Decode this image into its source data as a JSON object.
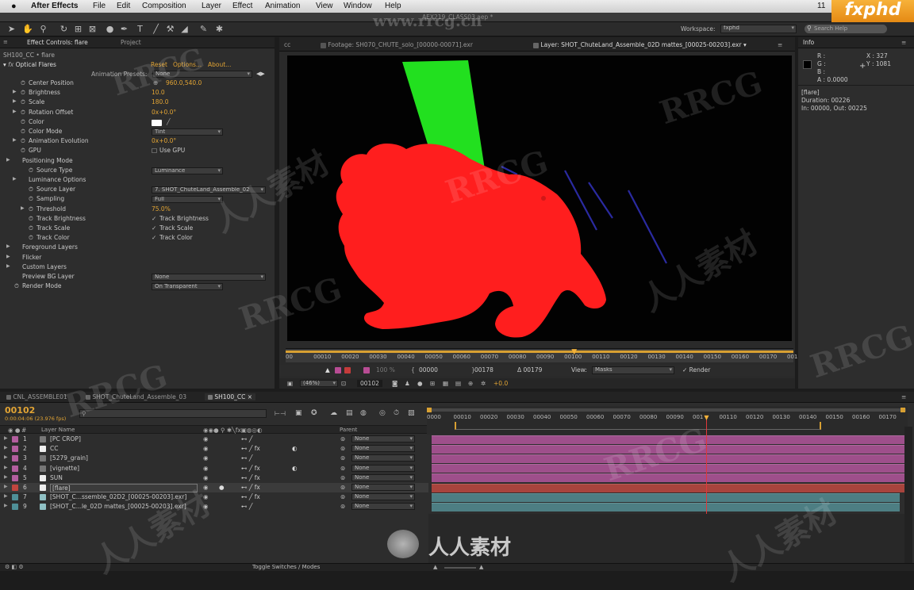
{
  "menubar": {
    "app_name": "After Effects",
    "items": [
      "File",
      "Edit",
      "Composition",
      "Layer",
      "Effect",
      "Animation",
      "View",
      "Window",
      "Help"
    ],
    "title": "AEX219_CLASS03.aep *",
    "clock": "11",
    "logo_text": "fxphd"
  },
  "toolbar": {
    "workspace_label": "Workspace:",
    "workspace_value": "fxphd",
    "search_placeholder": "Search Help"
  },
  "effect_controls": {
    "tab_label": "Effect Controls: flare",
    "tab_project": "Project",
    "subtitle": "SH100_CC • flare",
    "effect_name": "Optical Flares",
    "reset": "Reset",
    "options": "Options...",
    "about": "About...",
    "anim_presets_label": "Animation Presets:",
    "anim_presets_value": "None",
    "properties": [
      {
        "label": "Center Position",
        "value": "960.0,540.0",
        "indent": 1,
        "twirl": false
      },
      {
        "label": "Brightness",
        "value": "10.0",
        "indent": 1,
        "twirl": true
      },
      {
        "label": "Scale",
        "value": "180.0",
        "indent": 1,
        "twirl": true
      },
      {
        "label": "Rotation Offset",
        "value": "0x+0.0°",
        "indent": 1,
        "twirl": true
      },
      {
        "label": "Color",
        "value": "",
        "indent": 1,
        "twirl": false
      },
      {
        "label": "Color Mode",
        "value": "Tint",
        "indent": 1,
        "twirl": false
      },
      {
        "label": "Animation Evolution",
        "value": "0x+0.0°",
        "indent": 1,
        "twirl": true
      },
      {
        "label": "GPU",
        "value": "Use GPU",
        "indent": 1,
        "twirl": false
      },
      {
        "label": "Positioning Mode",
        "value": "",
        "indent": 0,
        "twirl": true
      },
      {
        "label": "Source Type",
        "value": "Luminance",
        "indent": 2,
        "twirl": false
      },
      {
        "label": "Luminance Options",
        "value": "",
        "indent": 1,
        "twirl": true
      },
      {
        "label": "Source Layer",
        "value": "7. SHOT_ChuteLand_Assemble_02",
        "indent": 2,
        "twirl": false
      },
      {
        "label": "Sampling",
        "value": "Full",
        "indent": 2,
        "twirl": false
      },
      {
        "label": "Threshold",
        "value": "75.0%",
        "indent": 2,
        "twirl": true
      },
      {
        "label": "Track Brightness",
        "value": "Track Brightness",
        "indent": 2,
        "twirl": false
      },
      {
        "label": "Track Scale",
        "value": "Track Scale",
        "indent": 2,
        "twirl": false
      },
      {
        "label": "Track Color",
        "value": "Track Color",
        "indent": 2,
        "twirl": false
      },
      {
        "label": "Foreground Layers",
        "value": "",
        "indent": 0,
        "twirl": true
      },
      {
        "label": "Flicker",
        "value": "",
        "indent": 0,
        "twirl": true
      },
      {
        "label": "Custom Layers",
        "value": "",
        "indent": 0,
        "twirl": true
      },
      {
        "label": "Preview BG Layer",
        "value": "None",
        "indent": 0,
        "twirl": false
      },
      {
        "label": "Render Mode",
        "value": "On Transparent",
        "indent": 0,
        "twirl": false
      }
    ]
  },
  "viewer": {
    "tab_footage": "Footage: SH070_CHUTE_solo_[00000-00071].exr",
    "tab_layer": "Layer: SHOT_ChuteLand_Assemble_02D mattes_[00025-00203].exr",
    "ruler_ticks": [
      "00",
      "00010",
      "00020",
      "00030",
      "00040",
      "00050",
      "00060",
      "00070",
      "00080",
      "00090",
      "00100",
      "00110",
      "00120",
      "00130",
      "00140",
      "00150",
      "00160",
      "00170",
      "001"
    ],
    "zoom_label": "100 %",
    "in_point": "00000",
    "out_point": "00178",
    "duration": "Δ 00179",
    "view_label": "View:",
    "view_value": "Masks",
    "render_label": "Render",
    "zoom_value": "(46%)",
    "frame": "00102",
    "exposure": "+0.0",
    "playhead_fraction": 0.57
  },
  "info": {
    "tab": "Info",
    "r": "R :",
    "g": "G :",
    "b": "B :",
    "a": "A : 0.0000",
    "x": "X : 327",
    "y": "Y : 1081",
    "layer": "[flare]",
    "duration": "Duration: 00226",
    "inout": "In: 00000, Out: 00225"
  },
  "timeline": {
    "tabs": [
      "CNL_ASSEMBLE01",
      "SHOT_ChuteLand_Assemble_03",
      "SH100_CC"
    ],
    "timecode": "00102",
    "timecode_sub": "0:00:04:06 (23.976 fps)",
    "search_placeholder": "",
    "col_layer_name": "Layer Name",
    "col_parent": "Parent",
    "ruler_ticks": [
      "0000",
      "00010",
      "00020",
      "00030",
      "00040",
      "00050",
      "00060",
      "00070",
      "00080",
      "00090",
      "001",
      "00110",
      "00120",
      "00130",
      "00140",
      "00150",
      "00160",
      "00170"
    ],
    "playhead_fraction": 0.58,
    "layers": [
      {
        "num": "1",
        "name": "[PC CROP]",
        "color": "#b35e9f",
        "parent": "None",
        "fx": false,
        "bar": "#9e4f8b"
      },
      {
        "num": "2",
        "name": "CC",
        "color": "#b35e9f",
        "parent": "None",
        "fx": true,
        "bar": "#9e4f8b"
      },
      {
        "num": "3",
        "name": "[5279_grain]",
        "color": "#b35e9f",
        "parent": "None",
        "fx": false,
        "bar": "#9e4f8b"
      },
      {
        "num": "4",
        "name": "[vignette]",
        "color": "#b35e9f",
        "parent": "None",
        "fx": true,
        "bar": "#9e4f8b"
      },
      {
        "num": "5",
        "name": "SUN",
        "color": "#b35e9f",
        "parent": "None",
        "fx": true,
        "bar": "#9e4f8b"
      },
      {
        "num": "6",
        "name": "[flare]",
        "color": "#c0453f",
        "parent": "None",
        "fx": true,
        "bar": "#a8443d"
      },
      {
        "num": "7",
        "name": "[SHOT_C...ssemble_02D2_[00025-00203].exr]",
        "color": "#4f8f97",
        "parent": "None",
        "fx": true,
        "bar": "#4d7e83"
      },
      {
        "num": "9",
        "name": "[SHOT_C...le_02D mattes_[00025-00203].exr]",
        "color": "#4f8f97",
        "parent": "None",
        "fx": false,
        "bar": "#4d7e83"
      }
    ],
    "toggle_label": "Toggle Switches / Modes"
  },
  "watermarks": [
    "RRCG",
    "人人素材",
    "www.rrcg.cn",
    "人人素材"
  ],
  "colors": {
    "accent": "#e2a434",
    "green_matte": "#22e01f",
    "red_matte": "#ff1e1e"
  }
}
